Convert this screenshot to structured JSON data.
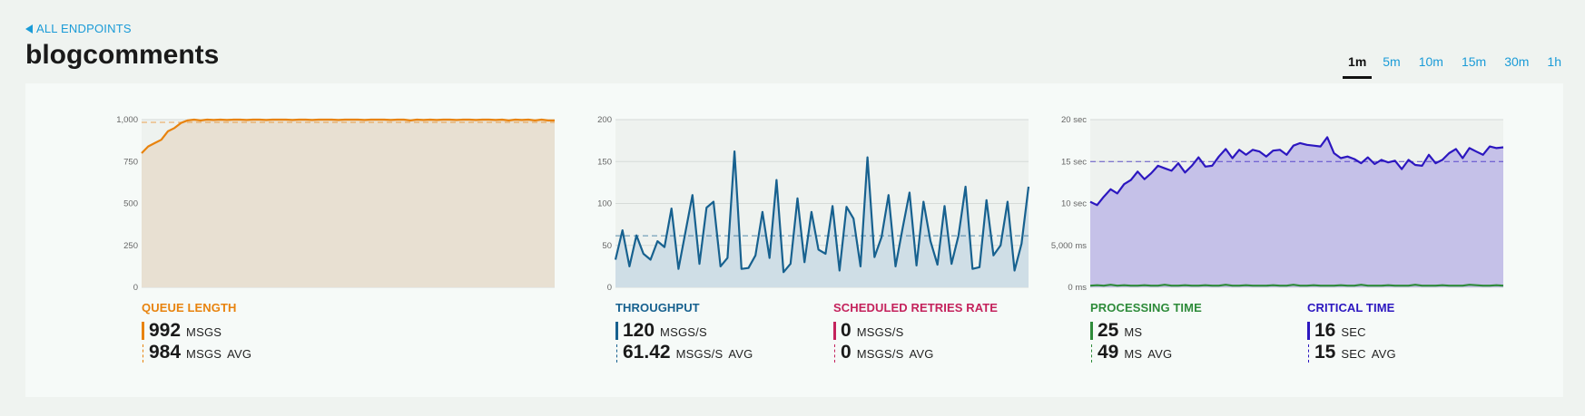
{
  "nav": {
    "back_label": "ALL ENDPOINTS"
  },
  "title": "blogcomments",
  "time_tabs": [
    {
      "label": "1m",
      "active": true
    },
    {
      "label": "5m",
      "active": false
    },
    {
      "label": "10m",
      "active": false
    },
    {
      "label": "15m",
      "active": false
    },
    {
      "label": "30m",
      "active": false
    },
    {
      "label": "1h",
      "active": false
    }
  ],
  "metrics": {
    "queue_length": {
      "title": "QUEUE LENGTH",
      "color": "#e8830e",
      "value": "992",
      "unit": "MSGS",
      "avg_value": "984",
      "avg_unit": "MSGS",
      "avg_label": "AVG"
    },
    "throughput": {
      "title": "THROUGHPUT",
      "color": "#17618f",
      "value": "120",
      "unit": "MSGS/S",
      "avg_value": "61.42",
      "avg_unit": "MSGS/S",
      "avg_label": "AVG"
    },
    "retries": {
      "title": "SCHEDULED RETRIES RATE",
      "color": "#c4225c",
      "value": "0",
      "unit": "MSGS/S",
      "avg_value": "0",
      "avg_unit": "MSGS/S",
      "avg_label": "AVG"
    },
    "processing_time": {
      "title": "PROCESSING TIME",
      "color": "#2e8b3a",
      "value": "25",
      "unit": "MS",
      "avg_value": "49",
      "avg_unit": "MS",
      "avg_label": "AVG"
    },
    "critical_time": {
      "title": "CRITICAL TIME",
      "color": "#2c17c0",
      "value": "16",
      "unit": "SEC",
      "avg_value": "15",
      "avg_unit": "SEC",
      "avg_label": "AVG"
    }
  },
  "chart_data": [
    {
      "type": "area",
      "ylim": [
        0,
        1000
      ],
      "yticks": [
        {
          "v": 0,
          "label": "0"
        },
        {
          "v": 250,
          "label": "250"
        },
        {
          "v": 500,
          "label": "500"
        },
        {
          "v": 750,
          "label": "750"
        },
        {
          "v": 1000,
          "label": "1,000"
        }
      ],
      "series": [
        {
          "key": "queue_length",
          "color": "#e8830e",
          "fill": "#e8e0d2",
          "avg": 984,
          "values": [
            800,
            840,
            860,
            880,
            930,
            950,
            980,
            995,
            1000,
            995,
            1000,
            998,
            1000,
            998,
            1000,
            1000,
            998,
            1000,
            1000,
            998,
            1000,
            1000,
            1000,
            998,
            1000,
            1000,
            998,
            1000,
            1000,
            1000,
            998,
            1000,
            1000,
            1000,
            998,
            1000,
            1000,
            1000,
            998,
            1000,
            1000,
            995,
            1000,
            998,
            1000,
            998,
            1000,
            1000,
            998,
            1000,
            1000,
            998,
            1000,
            1000,
            998,
            1000,
            995,
            1000,
            998,
            1000,
            995,
            1000,
            995,
            995
          ]
        }
      ]
    },
    {
      "type": "area",
      "ylim": [
        0,
        200
      ],
      "yticks": [
        {
          "v": 0,
          "label": "0"
        },
        {
          "v": 50,
          "label": "50"
        },
        {
          "v": 100,
          "label": "100"
        },
        {
          "v": 150,
          "label": "150"
        },
        {
          "v": 200,
          "label": "200"
        }
      ],
      "series": [
        {
          "key": "throughput",
          "color": "#17618f",
          "fill": "#cfdee6",
          "avg": 61.42,
          "values": [
            33,
            68,
            25,
            62,
            40,
            33,
            55,
            48,
            94,
            22,
            66,
            110,
            28,
            95,
            102,
            25,
            35,
            162,
            22,
            23,
            38,
            90,
            35,
            128,
            18,
            28,
            106,
            30,
            90,
            45,
            40,
            97,
            20,
            96,
            82,
            25,
            155,
            36,
            60,
            110,
            25,
            70,
            113,
            26,
            102,
            55,
            27,
            97,
            28,
            62,
            120,
            22,
            24,
            104,
            38,
            50,
            102,
            20,
            52,
            120
          ]
        }
      ]
    },
    {
      "type": "area",
      "ylim": [
        0,
        20
      ],
      "yticks": [
        {
          "v": 0,
          "label": "0 ms"
        },
        {
          "v": 5,
          "label": "5,000 ms"
        },
        {
          "v": 10,
          "label": "10 sec"
        },
        {
          "v": 15,
          "label": "15 sec"
        },
        {
          "v": 20,
          "label": "20 sec"
        }
      ],
      "series": [
        {
          "key": "critical_time",
          "color": "#2c17c0",
          "fill": "#c5c1e8",
          "avg": 15,
          "values": [
            10.2,
            9.8,
            10.8,
            11.7,
            11.2,
            12.3,
            12.8,
            13.8,
            12.9,
            13.6,
            14.5,
            14.2,
            13.9,
            14.8,
            13.7,
            14.5,
            15.5,
            14.4,
            14.5,
            15.6,
            16.5,
            15.4,
            16.4,
            15.8,
            16.4,
            16.2,
            15.6,
            16.3,
            16.4,
            15.8,
            16.9,
            17.2,
            17.0,
            16.9,
            16.8,
            17.9,
            16.0,
            15.4,
            15.6,
            15.3,
            14.8,
            15.5,
            14.7,
            15.2,
            14.9,
            15.1,
            14.1,
            15.2,
            14.6,
            14.5,
            15.8,
            14.8,
            15.2,
            16.0,
            16.5,
            15.4,
            16.6,
            16.2,
            15.8,
            16.8,
            16.6,
            16.7
          ]
        },
        {
          "key": "processing_time",
          "color": "#2e8b3a",
          "fill": "none",
          "avg": 0.049,
          "values": [
            0.2,
            0.25,
            0.2,
            0.3,
            0.2,
            0.25,
            0.2,
            0.2,
            0.25,
            0.2,
            0.2,
            0.3,
            0.2,
            0.2,
            0.25,
            0.2,
            0.2,
            0.25,
            0.2,
            0.2,
            0.3,
            0.2,
            0.2,
            0.25,
            0.2,
            0.2,
            0.2,
            0.25,
            0.2,
            0.2,
            0.3,
            0.2,
            0.2,
            0.25,
            0.2,
            0.2,
            0.2,
            0.25,
            0.2,
            0.2,
            0.3,
            0.2,
            0.2,
            0.2,
            0.25,
            0.2,
            0.2,
            0.2,
            0.3,
            0.2,
            0.2,
            0.2,
            0.25,
            0.2,
            0.2,
            0.2,
            0.3,
            0.25,
            0.2,
            0.2,
            0.25,
            0.2
          ]
        }
      ]
    }
  ]
}
